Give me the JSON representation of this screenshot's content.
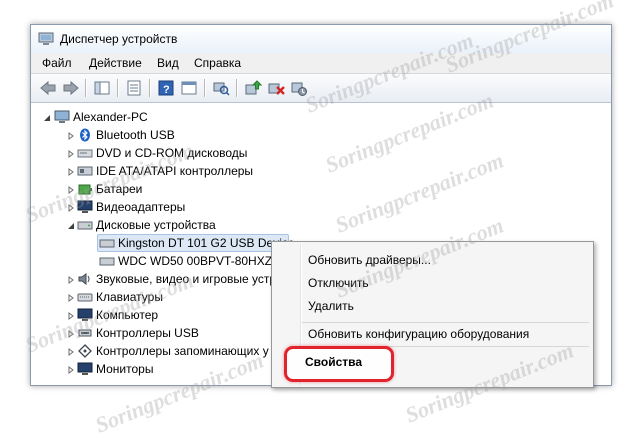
{
  "window": {
    "title": "Диспетчер устройств"
  },
  "menu": [
    "Файл",
    "Действие",
    "Вид",
    "Справка"
  ],
  "tree": {
    "root": "Alexander-PC",
    "items": [
      "Bluetooth USB",
      "DVD и CD-ROM дисководы",
      "IDE ATA/ATAPI контроллеры",
      "Батареи",
      "Видеоадаптеры",
      "Дисковые устройства",
      "Kingston DT 101 G2 USB Device",
      "WDC WD50 00BPVT-80HXZT3",
      "Звуковые, видео и игровые устр",
      "Клавиатуры",
      "Компьютер",
      "Контроллеры USB",
      "Контроллеры запоминающих у",
      "Мониторы"
    ]
  },
  "context_menu": {
    "items": [
      "Обновить драйверы...",
      "Отключить",
      "Удалить",
      "Обновить конфигурацию оборудования",
      "Свойства"
    ]
  },
  "watermark": "Soringpcrepair.com",
  "colors": {
    "highlight_border": "#e0232c",
    "selection": "#dce8f6"
  }
}
